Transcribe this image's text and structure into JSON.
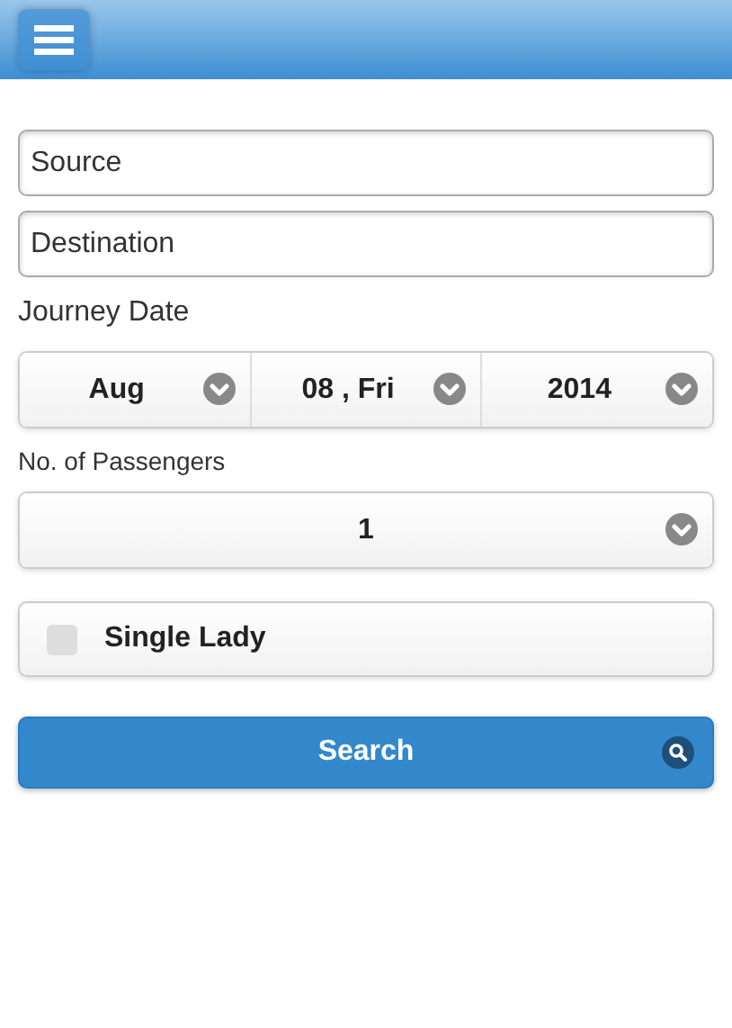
{
  "source": {
    "placeholder": "Source"
  },
  "destination": {
    "placeholder": "Destination"
  },
  "journey_date": {
    "label": "Journey Date",
    "selects": [
      {
        "value": "Aug"
      },
      {
        "value": "08 , Fri"
      },
      {
        "value": "2014"
      }
    ]
  },
  "passengers": {
    "label": "No. of Passengers",
    "value": "1"
  },
  "single_lady": {
    "label": "Single Lady",
    "checked": false
  },
  "search_button": {
    "label": "Search"
  }
}
